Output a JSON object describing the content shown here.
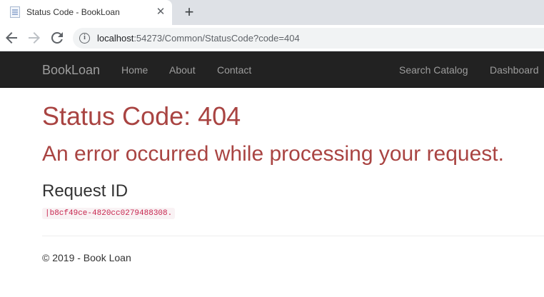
{
  "browser": {
    "tab_title": "Status Code - BookLoan",
    "tab_close_glyph": "✕",
    "new_tab_glyph": "+",
    "url_host": "localhost",
    "url_rest": ":54273/Common/StatusCode?code=404",
    "icons": [
      "page-favicon-icon",
      "close-icon",
      "plus-icon",
      "back-arrow-icon",
      "forward-arrow-icon",
      "reload-icon",
      "info-icon"
    ]
  },
  "navbar": {
    "brand": "BookLoan",
    "links": [
      "Home",
      "About",
      "Contact"
    ],
    "right_links": [
      "Search Catalog",
      "Dashboard"
    ],
    "background": "#222222",
    "link_color": "#9d9d9d"
  },
  "content": {
    "status_heading": "Status Code: 404",
    "error_message": "An error occurred while processing your request.",
    "request_id_label": "Request ID",
    "request_id_value": "|b8cf49ce-4820cc0279488308.",
    "error_color": "#a94442"
  },
  "footer": {
    "text": "© 2019 - Book Loan"
  }
}
